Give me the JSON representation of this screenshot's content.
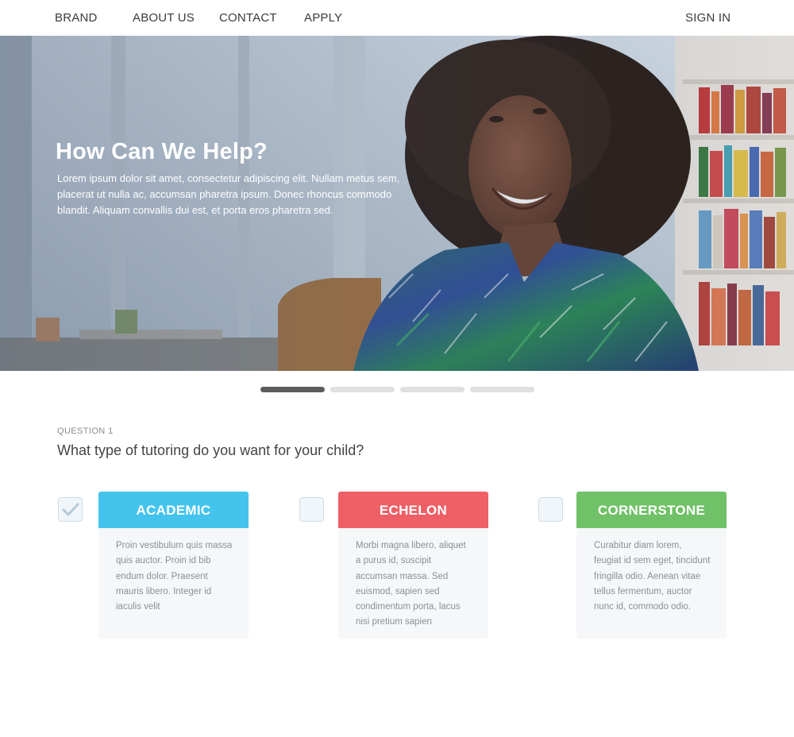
{
  "nav": {
    "brand": "BRAND",
    "about": "ABOUT US",
    "contact": "CONTACT",
    "apply": "APPLY",
    "signin": "SIGN IN"
  },
  "hero": {
    "title": "How Can We Help?",
    "text": "Lorem ipsum dolor sit amet, consectetur adipiscing elit. Nullam metus sem, placerat ut nulla ac, accumsan pharetra ipsum. Donec rhoncus commodo blandit. Aliquam convallis dui est, et porta eros pharetra sed."
  },
  "carousel": {
    "active_index": 0,
    "count": 4
  },
  "question": {
    "label": "QUESTION 1",
    "text": "What type of tutoring do you want for your child?"
  },
  "options": [
    {
      "title": "ACADEMIC",
      "color": "#44c4ed",
      "checked": true,
      "description": "Proin vestibulum quis massa quis auctor. Proin id bib endum dolor. Praesent mauris libero. Integer id iaculis velit"
    },
    {
      "title": "ECHELON",
      "color": "#ef5f66",
      "checked": false,
      "description": "Morbi magna libero, aliquet a purus id, suscipit accumsan massa. Sed euismod, sapien sed condimentum porta, lacus nisi pretium sapien"
    },
    {
      "title": "CORNERSTONE",
      "color": "#70c167",
      "checked": false,
      "description": "Curabitur diam lorem, feugiat id sem eget, tincidunt fringilla odio. Aenean vitae tellus fermentum, auctor nunc id, commodo odio."
    }
  ]
}
